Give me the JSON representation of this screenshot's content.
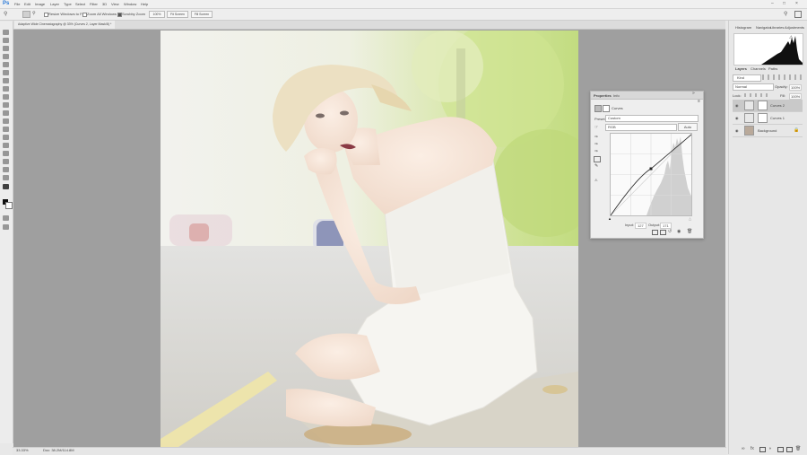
{
  "app": {
    "logo": "Ps"
  },
  "menu": [
    "File",
    "Edit",
    "Image",
    "Layer",
    "Type",
    "Select",
    "Filter",
    "3D",
    "View",
    "Window",
    "Help"
  ],
  "options_bar": {
    "resize_windows": "Resize Windows to Fit",
    "zoom_all": "Zoom All Windows",
    "scrubby_zoom": "Scrubby Zoom",
    "btn_100": "100%",
    "btn_fit": "Fit Screen",
    "btn_fill": "Fill Screen"
  },
  "document_tab": {
    "title": "Adaptive Wide Cinematography @ 33% (Curves 2, Layer Mask/8) *"
  },
  "status": {
    "zoom": "33.33%",
    "info": "Doc: 38.2M/114.8M"
  },
  "properties": {
    "tab1": "Properties",
    "tab2": "Info",
    "header": "Curves",
    "preset_label": "Preset:",
    "preset_value": "Custom",
    "channel_value": "RGB",
    "auto_btn": "Auto",
    "input_label": "Input:",
    "input_value": "127",
    "output_label": "Output:",
    "output_value": "171"
  },
  "panels": {
    "histogram_tabs": [
      "Histogram",
      "Navigator",
      "Libraries",
      "Adjustments"
    ],
    "layers_tabs": [
      "Layers",
      "Channels",
      "Paths"
    ],
    "kind_filter": "Kind",
    "blend_mode": "Normal",
    "opacity_label": "Opacity:",
    "opacity_value": "100%",
    "lock_label": "Lock:",
    "fill_label": "Fill:",
    "fill_value": "100%"
  },
  "layers": [
    {
      "name": "Curves 2",
      "selected": true
    },
    {
      "name": "Curves 1",
      "selected": false
    },
    {
      "name": "Background",
      "selected": false
    }
  ]
}
